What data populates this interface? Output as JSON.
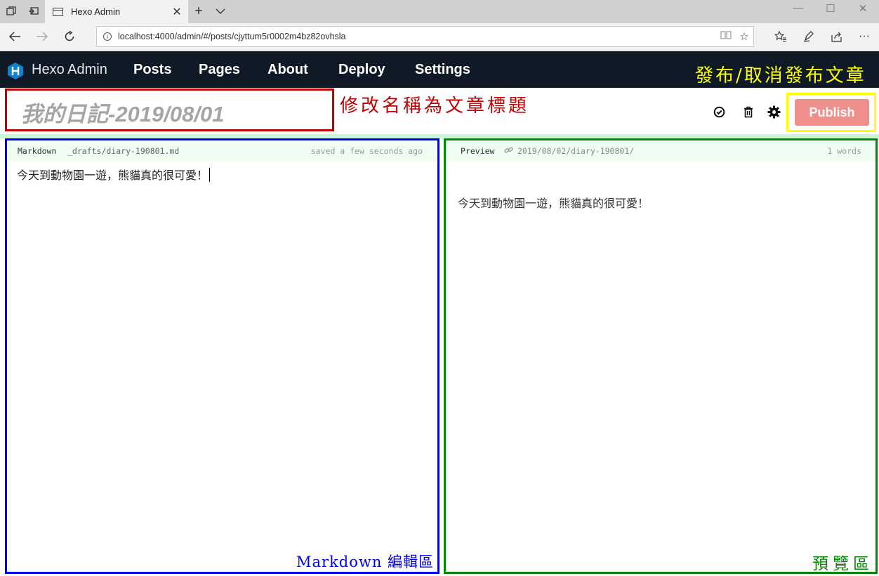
{
  "browser": {
    "tab_title": "Hexo Admin",
    "url": "localhost:4000/admin/#/posts/cjyttum5r0002m4bz82ovhsla"
  },
  "app": {
    "brand": "Hexo Admin",
    "nav": [
      "Posts",
      "Pages",
      "About",
      "Deploy",
      "Settings"
    ]
  },
  "annotations": {
    "publish_note": "發布/取消發布文章",
    "title_note": "修改名稱為文章標題",
    "editor_note": "Markdown 編輯區",
    "preview_note": "預覽區"
  },
  "post": {
    "title": "我的日記-2019/08/01",
    "publish_label": "Publish"
  },
  "editor": {
    "mode": "Markdown",
    "file": "_drafts/diary-190801.md",
    "status": "saved a few seconds ago",
    "content": "今天到動物園一遊，熊貓真的很可愛！"
  },
  "preview": {
    "label": "Preview",
    "permalink": "2019/08/02/diary-190801/",
    "word_count": "1 words",
    "content": "今天到動物園一遊，熊貓真的很可愛！"
  },
  "colors": {
    "navbar": "#101a26",
    "publish": "#ef8f8c",
    "title_box": "#c00000",
    "publish_box": "#ffff00",
    "editor_box": "#0000ee",
    "preview_box": "#008800",
    "header_bg": "#eefef2"
  },
  "icons": [
    "tab-actions-icon",
    "set-aside-icon",
    "page-icon",
    "close-icon",
    "new-tab-icon",
    "chevron-down-icon",
    "back-icon",
    "forward-icon",
    "refresh-icon",
    "info-icon",
    "reading-view-icon",
    "favorite-icon",
    "favorites-hub-icon",
    "pen-icon",
    "share-icon",
    "more-icon",
    "hexo-logo-icon",
    "check-circle-icon",
    "trash-icon",
    "gear-icon",
    "link-icon"
  ]
}
